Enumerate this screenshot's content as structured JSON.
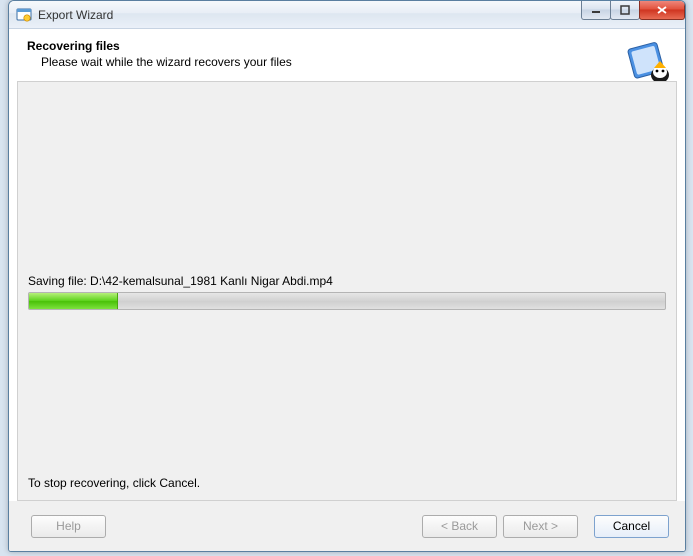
{
  "window": {
    "title": "Export Wizard"
  },
  "header": {
    "title": "Recovering files",
    "subtitle": "Please wait while the wizard recovers your files"
  },
  "body": {
    "status_prefix": "Saving file: ",
    "current_file": "D:\\42-kemalsunal_1981 Kanlı Nigar Abdi.mp4",
    "stop_hint": "To stop recovering, click Cancel.",
    "progress_percent": 14
  },
  "buttons": {
    "help": "Help",
    "back": "< Back",
    "next": "Next >",
    "cancel": "Cancel"
  }
}
